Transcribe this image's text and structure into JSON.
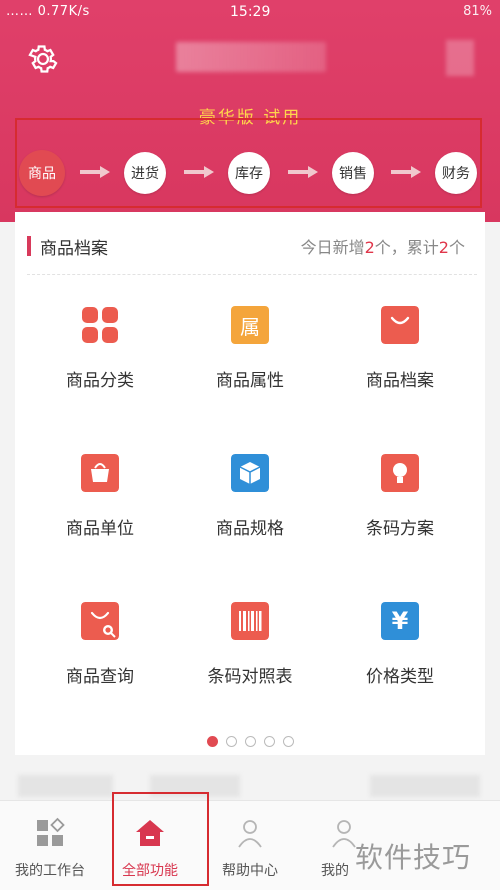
{
  "status": {
    "left": "…… 0.77K/s",
    "time": "15:29",
    "right": "81%"
  },
  "header": {
    "edition": "豪华版 试用"
  },
  "flow": [
    {
      "label": "商品",
      "active": true
    },
    {
      "label": "进货"
    },
    {
      "label": "库存"
    },
    {
      "label": "销售"
    },
    {
      "label": "财务"
    }
  ],
  "card": {
    "title": "商品档案",
    "stats_prefix": "今日新增",
    "stats_new": "2",
    "stats_mid": "个，累计",
    "stats_total": "2",
    "stats_suffix": "个",
    "items": [
      {
        "label": "商品分类",
        "icon": "category-icon",
        "color": "#ec5c4f"
      },
      {
        "label": "商品属性",
        "icon": "attribute-icon",
        "color": "#f4a53b",
        "glyph": "属"
      },
      {
        "label": "商品档案",
        "icon": "bag-icon",
        "color": "#ec5c4f"
      },
      {
        "label": "商品单位",
        "icon": "handbag-icon",
        "color": "#ec5c4f"
      },
      {
        "label": "商品规格",
        "icon": "box-icon",
        "color": "#2f8fd8"
      },
      {
        "label": "条码方案",
        "icon": "bulb-icon",
        "color": "#ec5c4f"
      },
      {
        "label": "商品查询",
        "icon": "search-bag-icon",
        "color": "#ec5c4f"
      },
      {
        "label": "条码对照表",
        "icon": "barcode-icon",
        "color": "#ec5c4f"
      },
      {
        "label": "价格类型",
        "icon": "yen-icon",
        "color": "#2f8fd8",
        "glyph": "¥"
      }
    ],
    "page_count": 5,
    "current_page": 1
  },
  "nav": [
    {
      "label": "我的工作台",
      "icon": "workbench-icon"
    },
    {
      "label": "全部功能",
      "icon": "home-icon",
      "active": true
    },
    {
      "label": "帮助中心",
      "icon": "help-icon"
    },
    {
      "label": "我的",
      "icon": "user-icon"
    }
  ],
  "watermark": "软件技巧",
  "colors": {
    "primary": "#d8375f",
    "accent": "#ffd54a",
    "highlight": "#d62b30"
  }
}
